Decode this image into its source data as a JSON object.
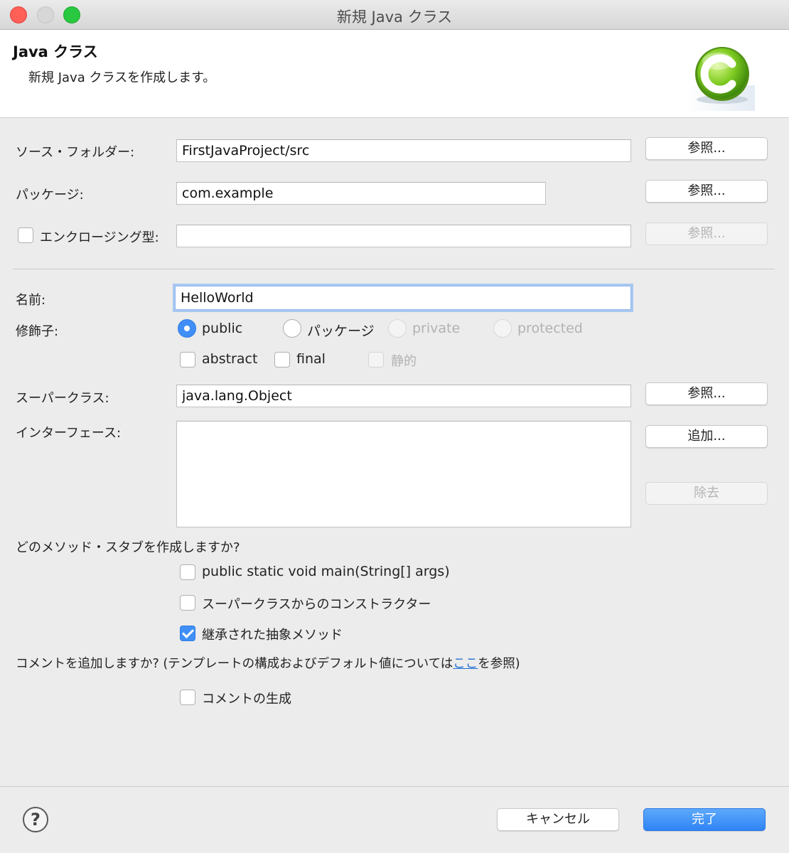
{
  "window": {
    "title": "新規 Java クラス"
  },
  "header": {
    "title": "Java クラス",
    "description": "新規 Java クラスを作成します。"
  },
  "source_folder": {
    "label": "ソース・フォルダー:",
    "value": "FirstJavaProject/src",
    "browse": "参照..."
  },
  "package": {
    "label": "パッケージ:",
    "value": "com.example",
    "browse": "参照..."
  },
  "enclosing_type": {
    "label": "エンクロージング型:",
    "value": "",
    "checked": false,
    "browse": "参照..."
  },
  "name": {
    "label": "名前:",
    "value": "HelloWorld"
  },
  "modifiers": {
    "label": "修飾子:",
    "access": [
      {
        "label": "public",
        "selected": true,
        "enabled": true
      },
      {
        "label": "パッケージ",
        "selected": false,
        "enabled": true
      },
      {
        "label": "private",
        "selected": false,
        "enabled": false
      },
      {
        "label": "protected",
        "selected": false,
        "enabled": false
      }
    ],
    "flags": [
      {
        "label": "abstract",
        "checked": false,
        "enabled": true
      },
      {
        "label": "final",
        "checked": false,
        "enabled": true
      },
      {
        "label": "静的",
        "checked": false,
        "enabled": false
      }
    ]
  },
  "superclass": {
    "label": "スーパークラス:",
    "value": "java.lang.Object",
    "browse": "参照..."
  },
  "interfaces": {
    "label": "インターフェース:",
    "add": "追加...",
    "remove": "除去"
  },
  "stubs": {
    "question": "どのメソッド・スタブを作成しますか?",
    "options": [
      {
        "label": "public static void main(String[] args)",
        "checked": false
      },
      {
        "label": "スーパークラスからのコンストラクター",
        "checked": false
      },
      {
        "label": "継承された抽象メソッド",
        "checked": true
      }
    ]
  },
  "comments": {
    "question_prefix": "コメントを追加しますか? (テンプレートの構成およびデフォルト値については",
    "link": "ここ",
    "question_suffix": "を参照)",
    "generate_label": "コメントの生成",
    "generate_checked": false
  },
  "footer": {
    "help": "?",
    "cancel": "キャンセル",
    "finish": "完了"
  },
  "colors": {
    "accent": "#3f8ff7",
    "primary_button": "#2f84f5",
    "link": "#1f6fd1"
  }
}
